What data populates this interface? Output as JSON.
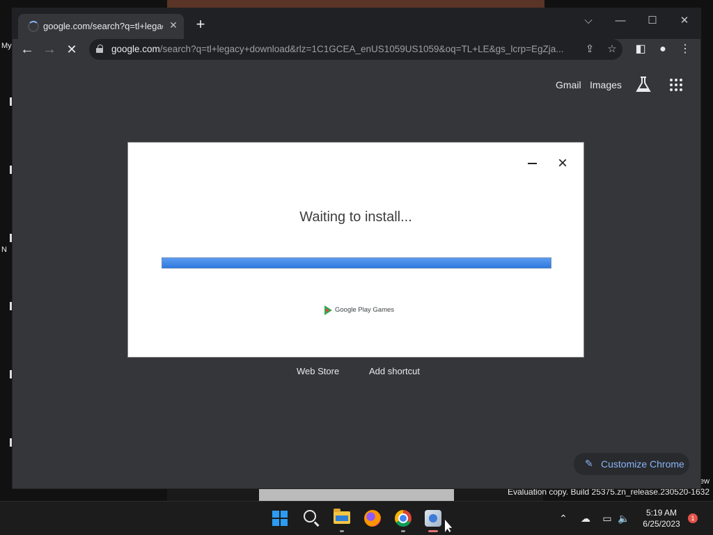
{
  "desktop": {
    "icon_label_1": "My",
    "icon_label_2": "N",
    "watermark_line_1": "ew",
    "watermark_line_2": "Evaluation copy. Build 25375.zn_release.230520-1632"
  },
  "browser": {
    "tab": {
      "title": "google.com/search?q=tl+legacy",
      "loading": true
    },
    "url_host": "google.com",
    "url_rest": "/search?q=tl+legacy+download&rlz=1C1GCEA_enUS1059US1059&oq=TL+LE&gs_lcrp=EgZja...",
    "top_links": {
      "gmail": "Gmail",
      "images": "Images"
    },
    "shortcuts": {
      "web_store": "Web Store",
      "add_shortcut": "Add shortcut"
    },
    "customize_label": "Customize Chrome",
    "accent_color": "#8ab4f8"
  },
  "install_dialog": {
    "status": "Waiting to install...",
    "progress_percent": 100,
    "brand": "Google Play Games"
  },
  "taskbar": {
    "time": "5:19 AM",
    "date": "6/25/2023",
    "notification_count": "1",
    "apps": [
      "start-icon",
      "search-icon",
      "file-explorer-icon",
      "firefox-icon",
      "chrome-icon",
      "installer-icon"
    ]
  }
}
